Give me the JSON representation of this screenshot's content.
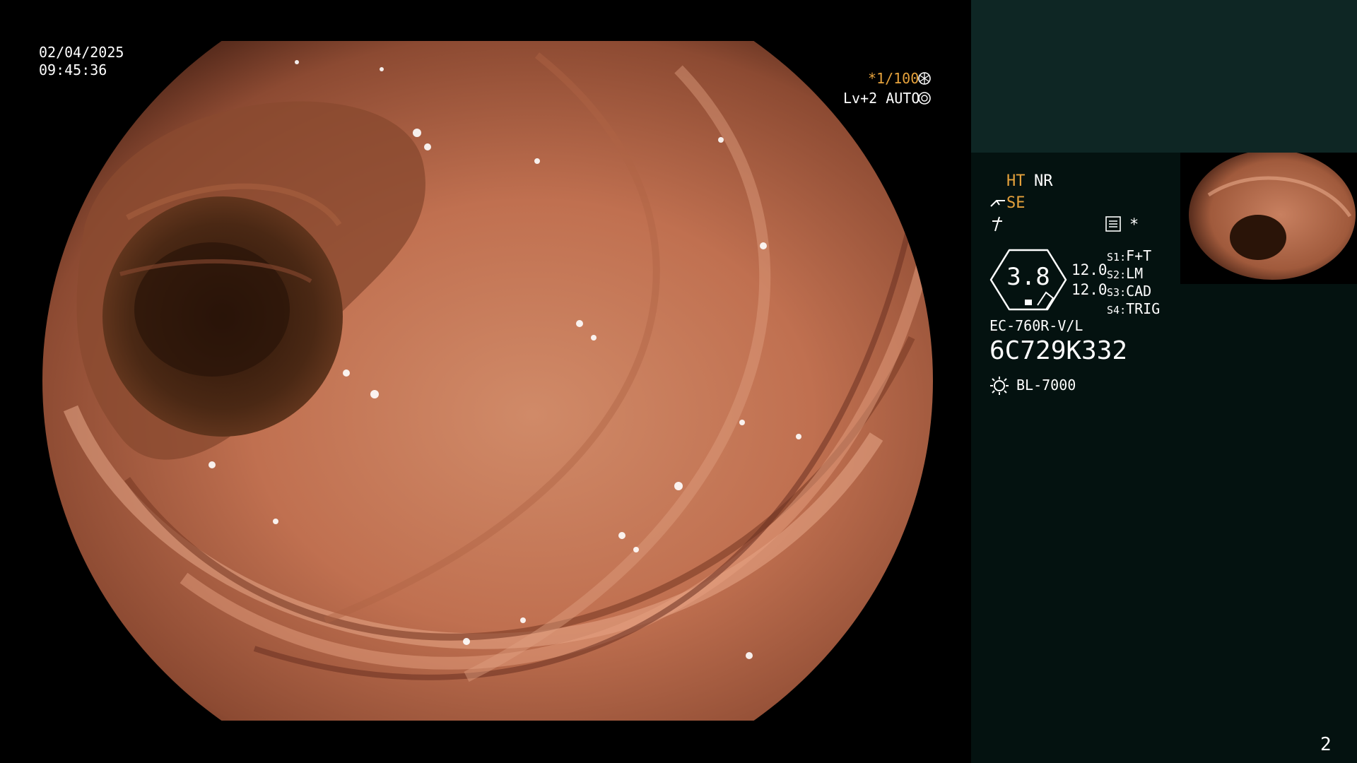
{
  "timestamp": {
    "date": "02/04/2025",
    "time": "09:45:36"
  },
  "scope_overlay": {
    "shutter": "*1/100",
    "shutter_icon": "aperture-icon",
    "level": "Lv+2 AUTO",
    "auto_icon": "iris-icon"
  },
  "panel": {
    "ht": "HT",
    "nr": "NR",
    "se": "SE",
    "se_icon": "scope-tip-icon",
    "aux_icon": "lightning-icon",
    "menu_icon": "settings-list-icon",
    "asterisk": "*",
    "lens_value": "3.8",
    "range_top": "12.0",
    "range_bottom": "12.0",
    "switches": [
      {
        "key": "S1",
        "sep": ":",
        "value": "F+T"
      },
      {
        "key": "S2",
        "sep": ":",
        "value": "LM"
      },
      {
        "key": "S3",
        "sep": ":",
        "value": "CAD"
      },
      {
        "key": "S4",
        "sep": ":",
        "value": "TRIG"
      }
    ],
    "scope_model": "EC-760R-V/L",
    "serial": "6C729K332",
    "light_icon": "light-source-icon",
    "light_source": "BL-7000",
    "page_number": "2"
  },
  "colors": {
    "accent_orange": "#e6a23c",
    "panel_top": "#0e2624",
    "panel_bottom": "#041210"
  }
}
